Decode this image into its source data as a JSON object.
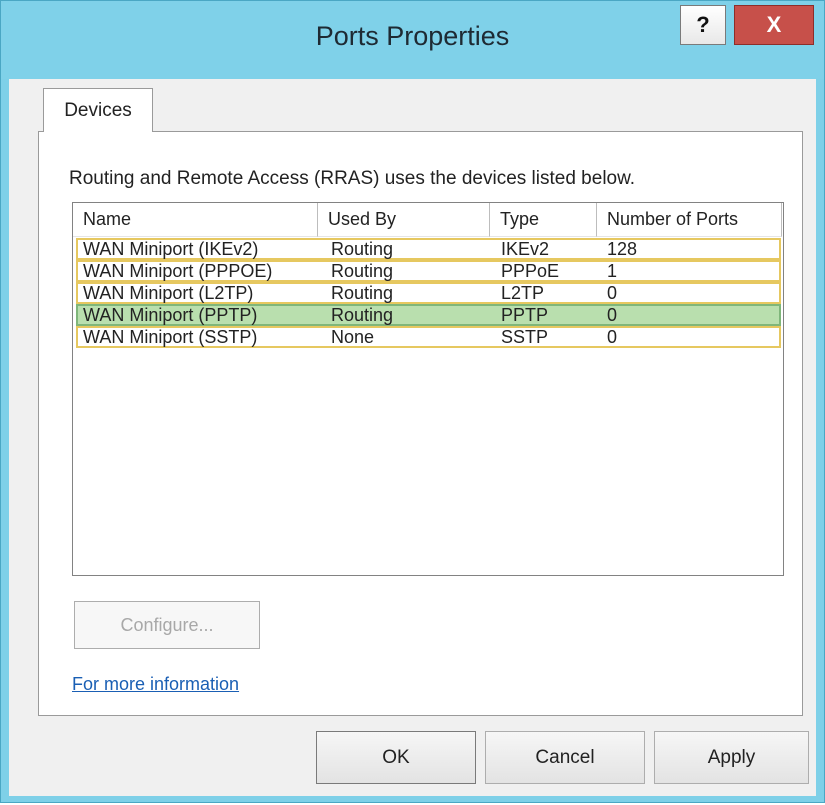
{
  "window": {
    "title": "Ports Properties",
    "help_label": "?",
    "close_label": "X"
  },
  "tabs": [
    {
      "label": "Devices",
      "selected": true
    }
  ],
  "description": "Routing and Remote Access (RRAS) uses the devices listed below.",
  "list": {
    "columns": [
      "Name",
      "Used By",
      "Type",
      "Number of Ports"
    ],
    "rows": [
      {
        "name": "WAN Miniport (IKEv2)",
        "used_by": "Routing",
        "type": "IKEv2",
        "ports": "128",
        "selected": false
      },
      {
        "name": "WAN Miniport (PPPOE)",
        "used_by": "Routing",
        "type": "PPPoE",
        "ports": "1",
        "selected": false
      },
      {
        "name": "WAN Miniport (L2TP)",
        "used_by": "Routing",
        "type": "L2TP",
        "ports": "0",
        "selected": false
      },
      {
        "name": "WAN Miniport (PPTP)",
        "used_by": "Routing",
        "type": "PPTP",
        "ports": "0",
        "selected": true
      },
      {
        "name": "WAN Miniport (SSTP)",
        "used_by": "None",
        "type": "SSTP",
        "ports": "0",
        "selected": false
      }
    ]
  },
  "buttons": {
    "configure": "Configure...",
    "more_info": "For more information",
    "ok": "OK",
    "cancel": "Cancel",
    "apply": "Apply"
  },
  "colors": {
    "titlebar": "#7fd1e9",
    "close": "#c7504a",
    "selected_row": "#b9dfae",
    "row_highlight_border": "#e6c860"
  }
}
